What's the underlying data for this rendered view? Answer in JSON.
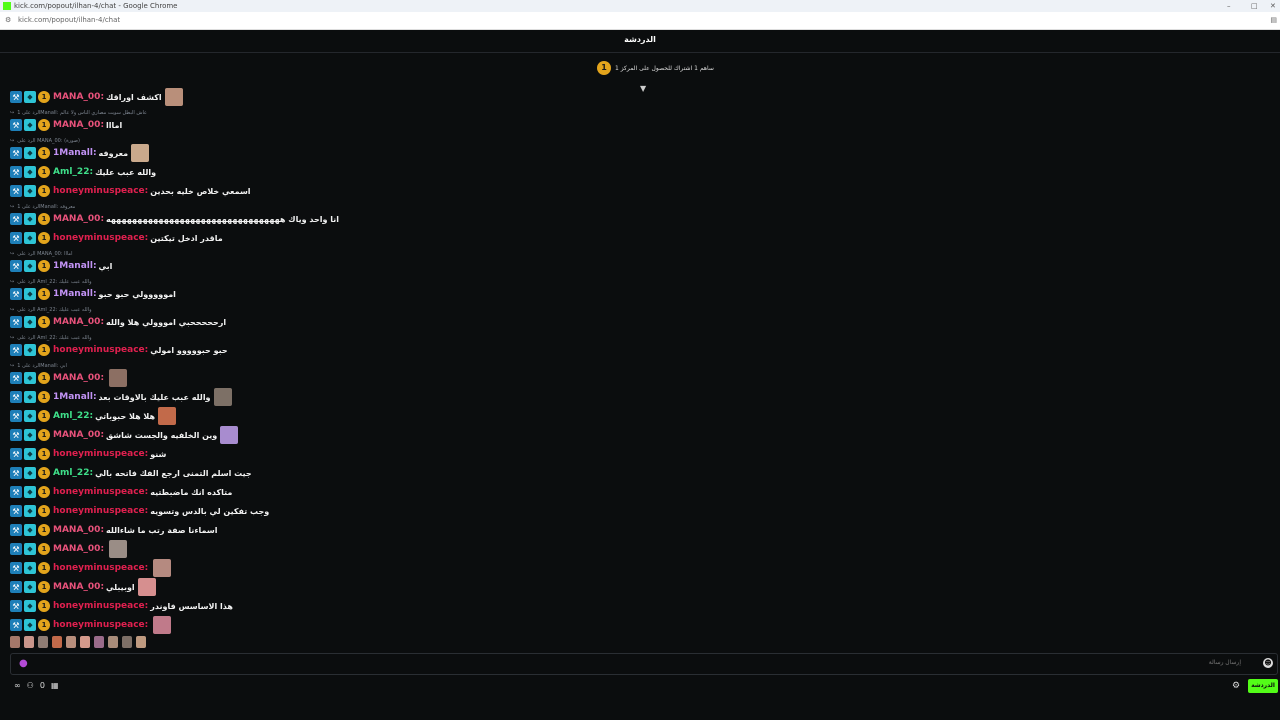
{
  "window": {
    "title": "kick.com/popout/ilhan-4/chat - Google Chrome"
  },
  "address": {
    "url": "kick.com/popout/ilhan-4/chat"
  },
  "chat": {
    "title": "الدردشة"
  },
  "pinned": {
    "badge": "1",
    "text": "ساهم 1 اشتراك للحصول على المركز 1"
  },
  "reply_label": "الرد على",
  "messages": [
    {
      "user": "MANA_00",
      "color": "#e8527b",
      "text": "اكشف اوراقك",
      "thumb": "#b98f7a"
    },
    {
      "user": "MANA_00",
      "color": "#e8527b",
      "text": "امااا",
      "reply": "الرد على 1Manall: عاش البطل سويت مصاري الناس ولا عالم"
    },
    {
      "user": "1Manall",
      "color": "#c293f5",
      "text": "معروفه",
      "thumb": "#caa98c",
      "reply": "الرد على MANA_00: (صورة)"
    },
    {
      "user": "Aml_22",
      "color": "#3fe08a",
      "text": "والله عبب عليك"
    },
    {
      "user": "honeyminuspeace",
      "color": "#e0204f",
      "text": "اسمعي خلاص خليه بحدين"
    },
    {
      "user": "MANA_00",
      "color": "#e8527b",
      "text": "انا واحد وياك هههههههههههههههههههههههههههههههههه",
      "reply": "الرد على 1Manall: معروفه"
    },
    {
      "user": "honeyminuspeace",
      "color": "#e0204f",
      "text": "ماقدر ادخل تيكتين"
    },
    {
      "user": "1Manall",
      "color": "#c293f5",
      "text": "ابي",
      "reply": "الرد على MANA_00: امااا"
    },
    {
      "user": "1Manall",
      "color": "#c293f5",
      "text": "امووووولي حبو حبو",
      "reply": "الرد على Aml_22: والله عبب عليك"
    },
    {
      "user": "MANA_00",
      "color": "#e8527b",
      "text": "ارحححححبي امووولي هلا والله",
      "reply": "الرد على Aml_22: والله عبب عليك"
    },
    {
      "user": "honeyminuspeace",
      "color": "#e0204f",
      "text": "حبو حبووووو امولي",
      "reply": "الرد على Aml_22: والله عبب عليك"
    },
    {
      "user": "MANA_00",
      "color": "#e8527b",
      "text": "",
      "thumb": "#8c6f63",
      "reply": "الرد على 1Manall: ابي"
    },
    {
      "user": "1Manall",
      "color": "#c293f5",
      "text": "والله عبب عليك بالاوقات بعد",
      "thumb": "#7d7066"
    },
    {
      "user": "Aml_22",
      "color": "#3fe08a",
      "text": "هلا هلا حبوباتي",
      "thumb": "#c26a4a"
    },
    {
      "user": "MANA_00",
      "color": "#e8527b",
      "text": "وين الخلفيه والجست شاشق",
      "thumb": "#a88ccf"
    },
    {
      "user": "honeyminuspeace",
      "color": "#e0204f",
      "text": "شنو"
    },
    {
      "user": "Aml_22",
      "color": "#3fe08a",
      "text": "جيت اسلم التمنى ارجع الفك فاتحه بالي"
    },
    {
      "user": "honeyminuspeace",
      "color": "#e0204f",
      "text": "متاكده انك ماضبطتيه"
    },
    {
      "user": "honeyminuspeace",
      "color": "#e0204f",
      "text": "وجب تفكين لي بالدس وتسويه"
    },
    {
      "user": "MANA_00",
      "color": "#e8527b",
      "text": "اسماءنا صفة رتب ما شاءالله"
    },
    {
      "user": "MANA_00",
      "color": "#e8527b",
      "text": "",
      "thumb": "#9a8d86"
    },
    {
      "user": "honeyminuspeace",
      "color": "#e0204f",
      "text": "",
      "thumb": "#b58a80"
    },
    {
      "user": "MANA_00",
      "color": "#e8527b",
      "text": "اوبيبلي",
      "thumb": "#d68f8f"
    },
    {
      "user": "honeyminuspeace",
      "color": "#e0204f",
      "text": "هذا الاساسس فاوندر"
    },
    {
      "user": "honeyminuspeace",
      "color": "#e0204f",
      "text": "",
      "thumb": "#c07a8a"
    }
  ],
  "emote_colors": [
    "#a5786a",
    "#c9958a",
    "#8f7c73",
    "#c26a4a",
    "#b88e7c",
    "#d49a8c",
    "#9a6b8a",
    "#a88c7a",
    "#7d6f66",
    "#bf9a80"
  ],
  "input": {
    "placeholder": "إرسال رسالة"
  },
  "footer": {
    "count": "0"
  },
  "send": {
    "label": "الدردشة"
  },
  "colors": {
    "accent": "#53fc18",
    "coin": "#e3a41c",
    "mic": "#b44bd6"
  }
}
